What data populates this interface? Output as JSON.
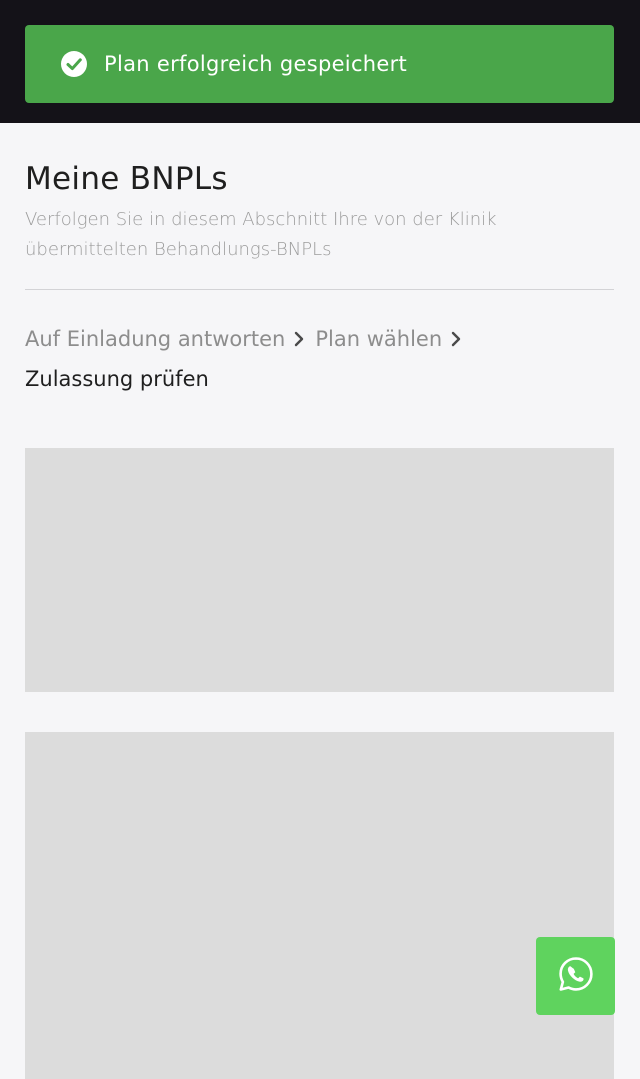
{
  "toast": {
    "message": "Plan erfolgreich gespeichert",
    "icon": "check-circle-icon",
    "color": "#4aa64a"
  },
  "page": {
    "title": "Meine BNPLs",
    "subtitle": "Verfolgen Sie in diesem Abschnitt Ihre von der Klinik übermittelten Behandlungs-BNPLs"
  },
  "breadcrumb": {
    "items": [
      {
        "label": "Auf Einladung antworten"
      },
      {
        "label": "Plan wählen"
      },
      {
        "label": "Zulassung prüfen"
      }
    ]
  },
  "fab": {
    "icon": "whatsapp-icon",
    "color": "#5fd35e"
  }
}
